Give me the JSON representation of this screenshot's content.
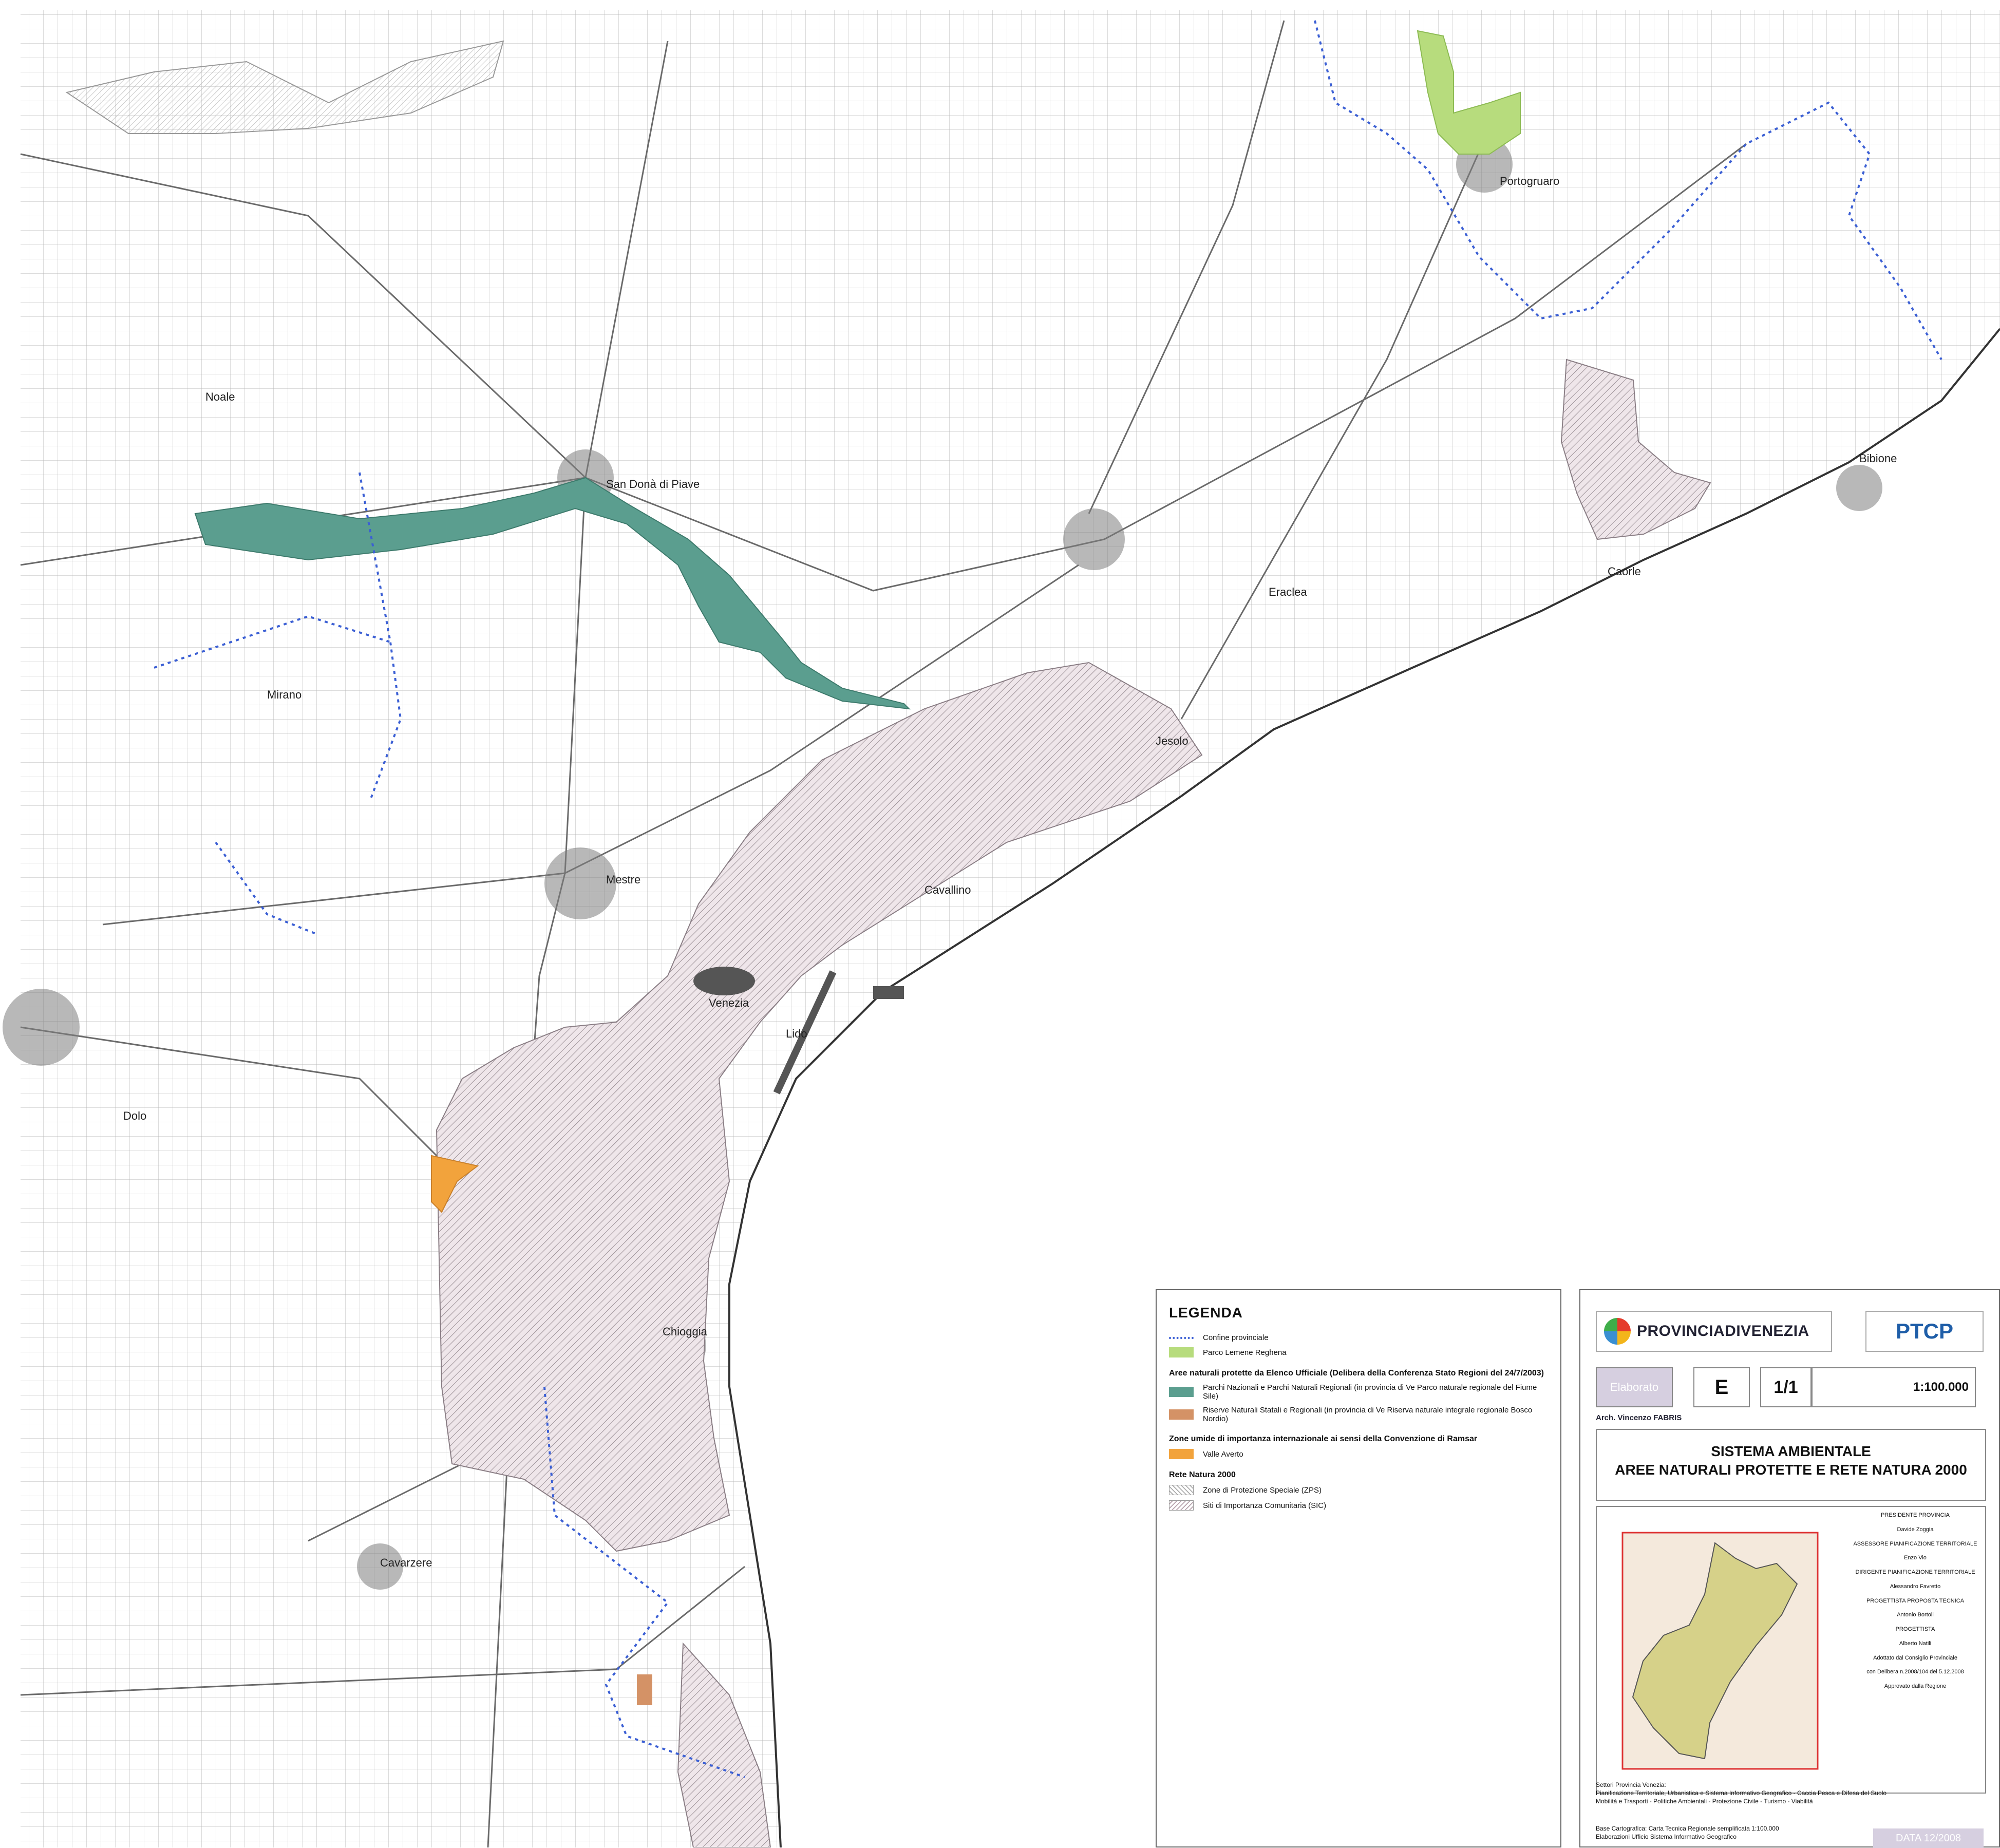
{
  "map": {
    "place_labels": [
      "Portogruaro",
      "San Donà di Piave",
      "Mestre",
      "Venezia",
      "Chioggia",
      "Jesolo",
      "Caorle",
      "Bibione",
      "Cavarzere",
      "Mirano",
      "Dolo",
      "Noale",
      "Lido",
      "Eraclea",
      "Cavallino"
    ],
    "colors": {
      "parco_lemene": "#b7dc7d",
      "parchi_nazionali": "#5b9e8f",
      "riserve": "#d49266",
      "valle_averto": "#f2a33c",
      "zps_hatch": "#9a8f95",
      "sic_fill": "#e3d6dc",
      "road": "#6a6a6a",
      "boundary": "#3b5fd4",
      "sea": "#ffffff"
    }
  },
  "legend": {
    "title": "LEGENDA",
    "confine": "Confine provinciale",
    "parco": "Parco Lemene Reghena",
    "section1": "Aree naturali protette da Elenco Ufficiale (Delibera della Conferenza Stato Regioni del 24/7/2003)",
    "parchi": "Parchi Nazionali e Parchi Naturali Regionali (in provincia di Ve Parco naturale regionale del Fiume Sile)",
    "riserve": "Riserve Naturali Statali e Regionali (in provincia di Ve Riserva naturale integrale regionale Bosco Nordio)",
    "section2": "Zone umide di importanza internazionale ai sensi della Convenzione di Ramsar",
    "valle": "Valle Averto",
    "section3": "Rete Natura 2000",
    "zps": "Zone di Protezione Speciale (ZPS)",
    "sic": "Siti di Importanza Comunitaria (SIC)"
  },
  "cartouche": {
    "logo_provincia": "PROVINCIADIVENEZIA",
    "logo_ptcp": "PTCP",
    "elaborato_label": "Elaborato",
    "elaborato_letter": "E",
    "elaborato_num": "1/1",
    "scale": "1:100.000",
    "signer": "Arch. Vincenzo FABRIS",
    "title1": "SISTEMA AMBIENTALE",
    "title2": "AREE NATURALI PROTETTE E RETE NATURA 2000",
    "credit_presidente": "PRESIDENTE PROVINCIA",
    "credit_presidente_name": "Davide Zoggia",
    "credit_assessore": "ASSESSORE PIANIFICAZIONE TERRITORIALE",
    "credit_assessore_name": "Enzo Vio",
    "credit_dirigente": "DIRIGENTE PIANIFICAZIONE TERRITORIALE",
    "credit_dirigente_name": "Alessandro Favretto",
    "credit_progettista": "PROGETTISTA PROPOSTA TECNICA",
    "credit_progettista_name": "Antonio Bortoli",
    "credit_progettista2": "PROGETTISTA",
    "credit_progettista2_name": "Alberto Natili",
    "credit_adottato": "Adottato dal Consiglio Provinciale",
    "credit_adottato_detail": "con Delibera n.2008/104 del 5.12.2008",
    "credit_approvato": "Approvato dalla Regione",
    "settori_title": "Settori Provincia Venezia:",
    "settori_line1": "Pianificazione Territoriale, Urbanistica e Sistema Informativo Geografico - Caccia Pesca e Difesa del Suolo",
    "settori_line2": "Mobilità e Trasporti - Politiche Ambientali - Protezione Civile - Turismo - Viabilità",
    "base1": "Base Cartografica: Carta Tecnica Regionale semplificata 1:100.000",
    "base2": "Elaborazioni Ufficio Sistema Informativo Geografico",
    "data": "DATA 12/2008"
  }
}
